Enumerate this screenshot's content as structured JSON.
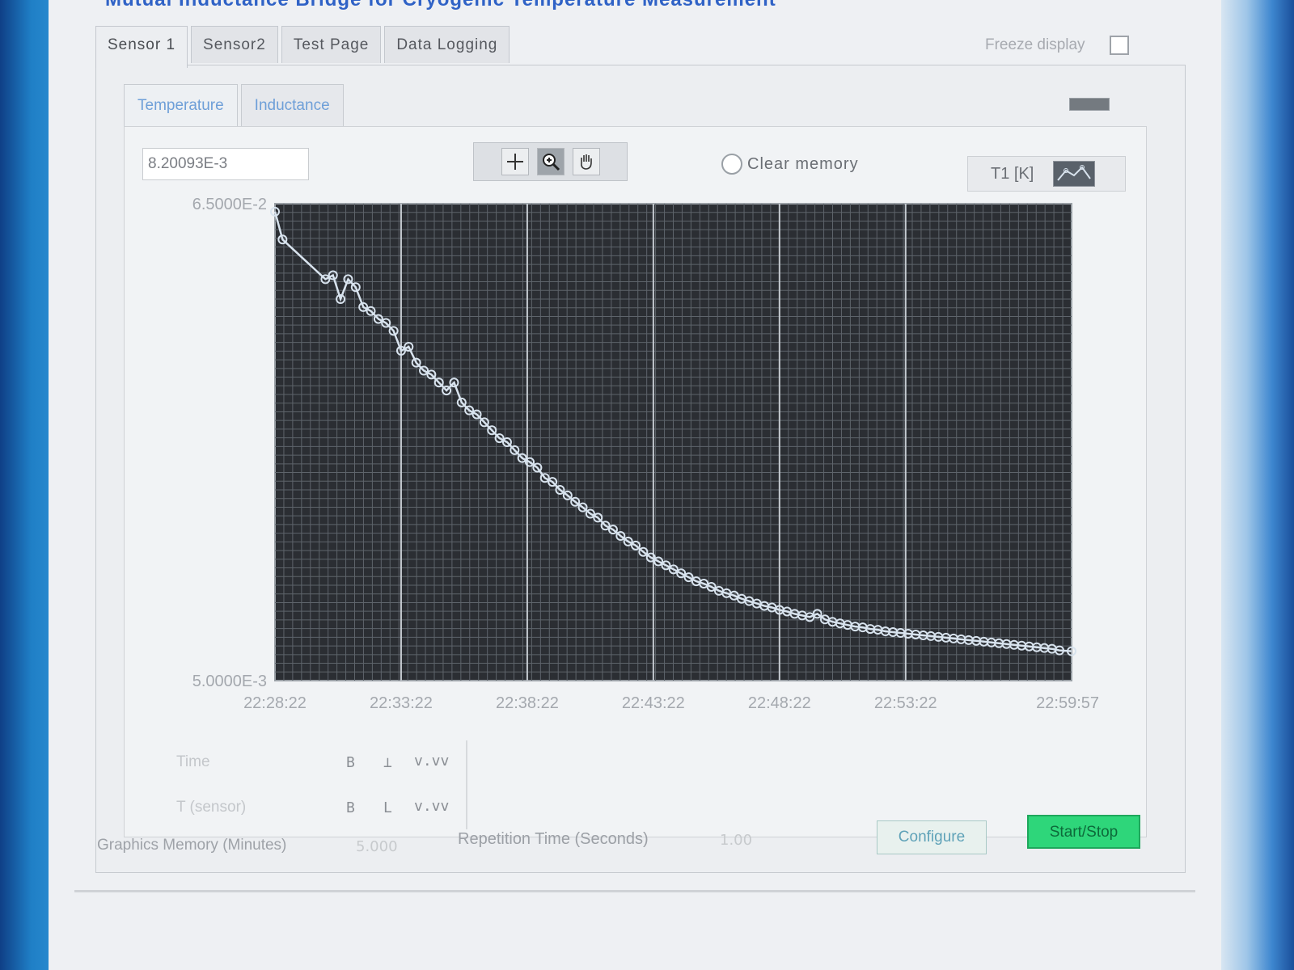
{
  "window": {
    "title": "Mutual Inductance Bridge for Cryogenic Temperature Measurement"
  },
  "tabs": [
    {
      "label": "Sensor 1",
      "active": true
    },
    {
      "label": "Sensor2",
      "active": false
    },
    {
      "label": "Test Page",
      "active": false
    },
    {
      "label": "Data Logging",
      "active": false
    }
  ],
  "freeze": {
    "label": "Freeze display",
    "checked": false
  },
  "subtabs": [
    {
      "label": "Temperature",
      "active": true
    },
    {
      "label": "Inductance",
      "active": false
    }
  ],
  "readout": {
    "value": "8.20093E-3"
  },
  "toolbar": {
    "tools": [
      {
        "icon": "crosshair-icon"
      },
      {
        "icon": "zoom-icon"
      },
      {
        "icon": "hand-pan-icon"
      }
    ]
  },
  "clear_memory": {
    "label": "Clear memory",
    "selected": false
  },
  "legend": {
    "label": "T1 [K]",
    "icon": "line-plot-icon"
  },
  "chart_data": {
    "type": "line",
    "title": "",
    "xlabel": "",
    "ylabel": "",
    "ylim": [
      0.005,
      0.065
    ],
    "y_tick_labels": [
      "6.5000E-2",
      "5.0000E-3"
    ],
    "x_tick_labels": [
      "22:28:22",
      "22:33:22",
      "22:38:22",
      "22:43:22",
      "22:48:22",
      "22:53:22",
      "22:59:57"
    ],
    "x_range_minutes": [
      0,
      31.58
    ],
    "grid": true,
    "background": "#2b2e33",
    "series": [
      {
        "color": "#d8e3ee",
        "marker": "circle",
        "x": [
          0,
          0.3,
          2.0,
          2.3,
          2.6,
          2.9,
          3.2,
          3.5,
          3.8,
          4.1,
          4.4,
          4.7,
          5.0,
          5.3,
          5.6,
          5.9,
          6.2,
          6.5,
          6.8,
          7.1,
          7.4,
          7.7,
          8.0,
          8.3,
          8.6,
          8.9,
          9.2,
          9.5,
          9.8,
          10.1,
          10.4,
          10.7,
          11.0,
          11.3,
          11.6,
          11.9,
          12.2,
          12.5,
          12.8,
          13.1,
          13.4,
          13.7,
          14.0,
          14.3,
          14.6,
          14.9,
          15.2,
          15.5,
          15.8,
          16.1,
          16.4,
          16.7,
          17.0,
          17.3,
          17.6,
          17.9,
          18.2,
          18.5,
          18.8,
          19.1,
          19.4,
          19.7,
          20.0,
          20.3,
          20.6,
          20.9,
          21.2,
          21.5,
          21.8,
          22.1,
          22.4,
          22.7,
          23.0,
          23.3,
          23.6,
          23.9,
          24.2,
          24.5,
          24.8,
          25.1,
          25.4,
          25.7,
          26.0,
          26.3,
          26.6,
          26.9,
          27.2,
          27.5,
          27.8,
          28.1,
          28.4,
          28.7,
          29.0,
          29.3,
          29.6,
          29.9,
          30.2,
          30.5,
          30.8,
          31.1,
          31.58
        ],
        "y": [
          0.064,
          0.0605,
          0.0555,
          0.056,
          0.053,
          0.0555,
          0.0545,
          0.052,
          0.0515,
          0.0505,
          0.05,
          0.049,
          0.0465,
          0.047,
          0.045,
          0.044,
          0.0435,
          0.0425,
          0.0415,
          0.0425,
          0.04,
          0.039,
          0.0385,
          0.0375,
          0.0365,
          0.0355,
          0.035,
          0.034,
          0.033,
          0.0325,
          0.0318,
          0.0305,
          0.03,
          0.029,
          0.0283,
          0.0275,
          0.0268,
          0.026,
          0.0255,
          0.0245,
          0.024,
          0.0232,
          0.0225,
          0.022,
          0.0212,
          0.0205,
          0.02,
          0.0195,
          0.019,
          0.0185,
          0.018,
          0.0175,
          0.0172,
          0.0168,
          0.0163,
          0.016,
          0.0157,
          0.0153,
          0.015,
          0.0147,
          0.0144,
          0.0142,
          0.0139,
          0.0137,
          0.0134,
          0.0132,
          0.013,
          0.0134,
          0.0127,
          0.0124,
          0.0122,
          0.012,
          0.0118,
          0.0117,
          0.0115,
          0.0114,
          0.0112,
          0.0111,
          0.011,
          0.0109,
          0.0108,
          0.0107,
          0.0106,
          0.0105,
          0.0104,
          0.0103,
          0.0102,
          0.0101,
          0.01,
          0.0099,
          0.0098,
          0.0097,
          0.0096,
          0.0095,
          0.0094,
          0.0093,
          0.0092,
          0.0091,
          0.009,
          0.0088,
          0.0087
        ]
      }
    ]
  },
  "controls": {
    "row1": {
      "label": "Time",
      "glyphs": [
        "B",
        "⊥",
        "v.vv"
      ]
    },
    "row2": {
      "label": "T (sensor)",
      "glyphs": [
        "B",
        "L",
        "v.vv"
      ]
    }
  },
  "graphics_memory": {
    "label": "Graphics Memory (Minutes)",
    "value": "5.000"
  },
  "repetition_time": {
    "label": "Repetition Time (Seconds)",
    "value": "1.00"
  },
  "buttons": {
    "configure": "Configure",
    "start_stop": "Start/Stop"
  }
}
